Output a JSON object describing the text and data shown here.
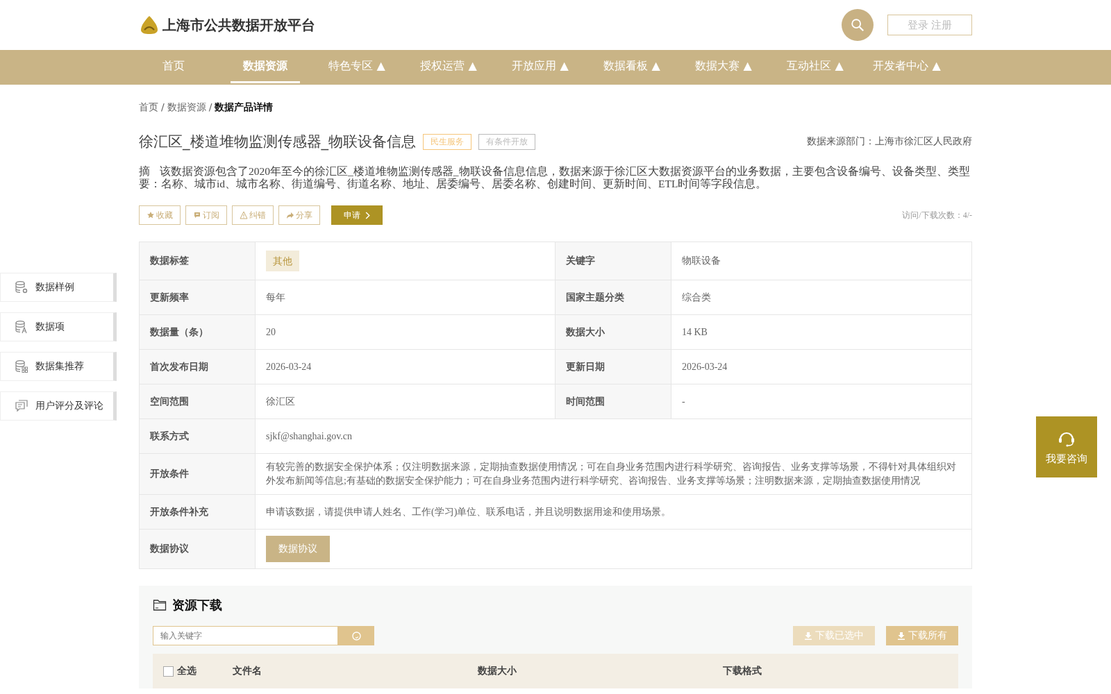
{
  "header": {
    "site_title": "上海市公共数据开放平台",
    "login_button": "登录 注册"
  },
  "nav": [
    {
      "label": "首页",
      "selected": false
    },
    {
      "label": "数据资源",
      "selected": true
    },
    {
      "label": "特色专区 ▲",
      "selected": false
    },
    {
      "label": "授权运营 ▲",
      "selected": false
    },
    {
      "label": "开放应用 ▲",
      "selected": false
    },
    {
      "label": "数据看板 ▲",
      "selected": false
    },
    {
      "label": "数据大赛 ▲",
      "selected": false
    },
    {
      "label": "互动社区 ▲",
      "selected": false
    },
    {
      "label": "开发者中心 ▲",
      "selected": false
    }
  ],
  "breadcrumb": [
    {
      "label": "首页",
      "kind": "link"
    },
    {
      "label": "/",
      "kind": "separator"
    },
    {
      "label": "数据资源",
      "kind": "link"
    },
    {
      "label": "/",
      "kind": "separator"
    },
    {
      "label": "数据产品详情",
      "kind": "current"
    }
  ],
  "dataset": {
    "title": "徐汇区_楼道堆物监测传感器_物联设备信息",
    "tags": [
      {
        "label": "民生服务",
        "color": "#f5c57a"
      },
      {
        "label": "有条件开放",
        "color": "#bbbbbb"
      }
    ],
    "source": "数据来源部门：上海市徐汇区人民政府",
    "abstract_label": "摘",
    "abstract": "该数据资源包含了2020年至今的徐汇区_楼道堆物监测传感器_物联设备信息信息，数据来源于徐汇区大数据资源平台的业务数据，主要包含设备编号、设备类型、类型要：名称、城市id、城市名称、街道编号、街道名称、地址、居委编号、居委名称、创建时间、更新时间、ETL时间等字段信息。",
    "actions": [
      {
        "label": "收藏"
      },
      {
        "label": "订阅"
      },
      {
        "label": "纠错"
      },
      {
        "label": "分享"
      }
    ],
    "apply_button": "申请",
    "visits": "访问/下载次数：4/-"
  },
  "sidebar": [
    {
      "label": "数据样例"
    },
    {
      "label": "数据项"
    },
    {
      "label": "数据集推荐"
    },
    {
      "label": "用户评分及评论"
    }
  ],
  "info_table": [
    {
      "cells": [
        {
          "label": "数据标签",
          "value": "其他",
          "kind": "tag"
        },
        {
          "label": "关键字",
          "value": "物联设备",
          "kind": "text"
        }
      ]
    },
    {
      "cells": [
        {
          "label": "更新频率",
          "value": "每年",
          "kind": "text"
        },
        {
          "label": "国家主题分类",
          "value": "综合类",
          "kind": "text"
        }
      ]
    },
    {
      "cells": [
        {
          "label": "数据量（条）",
          "value": "20",
          "kind": "text"
        },
        {
          "label": "数据大小",
          "value": "14 KB",
          "kind": "text"
        }
      ]
    },
    {
      "cells": [
        {
          "label": "首次发布日期",
          "value": "2026-03-24",
          "kind": "text"
        },
        {
          "label": "更新日期",
          "value": "2026-03-24",
          "kind": "text"
        }
      ]
    },
    {
      "cells": [
        {
          "label": "空间范围",
          "value": "徐汇区",
          "kind": "text"
        },
        {
          "label": "时间范围",
          "value": "-",
          "kind": "text"
        }
      ]
    },
    {
      "cells": [
        {
          "label": "联系方式",
          "value": "sjkf@shanghai.gov.cn",
          "kind": "text"
        }
      ]
    },
    {
      "cells": [
        {
          "label": "开放条件",
          "value": "有较完善的数据安全保护体系；仅注明数据来源，定期抽查数据使用情况；可在自身业务范围内进行科学研究、咨询报告、业务支撑等场景，不得针对具体组织对外发布新闻等信息;有基础的数据安全保护能力；可在自身业务范围内进行科学研究、咨询报告、业务支撑等场景；注明数据来源，定期抽查数据使用情况",
          "kind": "text"
        }
      ]
    },
    {
      "cells": [
        {
          "label": "开放条件补充",
          "value": "申请该数据，请提供申请人姓名、工作(学习)单位、联系电话，并且说明数据用途和使用场景。",
          "kind": "text"
        }
      ]
    },
    {
      "cells": [
        {
          "label": "数据协议",
          "value": "数据协议",
          "kind": "button"
        }
      ]
    }
  ],
  "downloads": {
    "title": "资源下载",
    "search": {
      "placeholder": "输入关键字"
    },
    "buttons": [
      {
        "label": "下载已选中",
        "disabled": true
      },
      {
        "label": "下载所有",
        "disabled": false
      }
    ],
    "columns": [
      {
        "label": "全选",
        "kind": "checkbox",
        "checked": false
      },
      {
        "label": "文件名",
        "kind": "text"
      },
      {
        "label": "数据大小",
        "kind": "text"
      },
      {
        "label": "下载格式",
        "kind": "text"
      }
    ]
  },
  "consult": {
    "label": "我要咨询"
  }
}
